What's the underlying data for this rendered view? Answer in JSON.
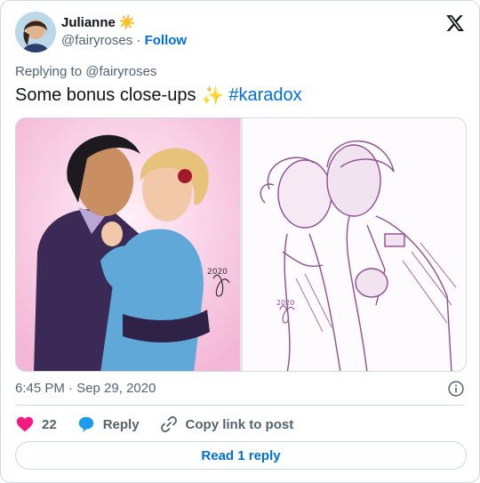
{
  "author": {
    "name": "Julianne",
    "name_emoji": "☀️",
    "handle": "@fairyroses",
    "separator": "·",
    "follow_label": "Follow"
  },
  "reply_to": {
    "prefix": "Replying to",
    "handle": "@fairyroses"
  },
  "tweet": {
    "text": "Some bonus close-ups",
    "emoji": "✨",
    "hashtag": "#karadox"
  },
  "media": {
    "signature_left": "2020",
    "signature_right": "2020"
  },
  "timestamp": "6:45 PM · Sep 29, 2020",
  "actions": {
    "like_count": "22",
    "reply_label": "Reply",
    "copy_link_label": "Copy link to post"
  },
  "read_reply_label": "Read 1 reply",
  "colors": {
    "link": "#006fd6",
    "heart": "#f91880",
    "reply_bubble": "#1d9bf0",
    "muted": "#536471",
    "border": "#cfd9de"
  }
}
